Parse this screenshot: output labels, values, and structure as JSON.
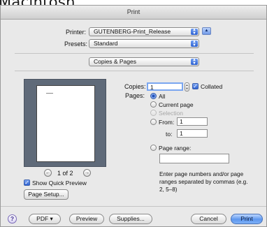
{
  "background": {
    "title": "Macintosh"
  },
  "window": {
    "title": "Print"
  },
  "printer": {
    "label": "Printer:",
    "value": "GUTENBERG-Print_Release"
  },
  "presets": {
    "label": "Presets:",
    "value": "Standard"
  },
  "section_popup": {
    "value": "Copies & Pages"
  },
  "copies": {
    "label": "Copies:",
    "value": "1",
    "collated_label": "Collated",
    "collated_checked": true
  },
  "pages": {
    "label": "Pages:",
    "all": "All",
    "current": "Current page",
    "selection": "Selection",
    "from_label": "From:",
    "from_value": "1",
    "to_label": "to:",
    "to_value": "1",
    "range_label": "Page range:",
    "range_value": "",
    "range_hint": "Enter page numbers and/or page ranges separated by commas (e.g. 2, 5–8)"
  },
  "preview": {
    "page_indicator": "1 of 2",
    "show_quick_preview_label": "Show Quick Preview",
    "show_quick_preview_checked": true
  },
  "buttons": {
    "page_setup": "Page Setup...",
    "help": "?",
    "pdf": "PDF ▾",
    "preview": "Preview",
    "supplies": "Supplies...",
    "cancel": "Cancel",
    "print": "Print"
  },
  "colors": {
    "accent": "#2f62d1",
    "preview_bg": "#5f6a79"
  }
}
